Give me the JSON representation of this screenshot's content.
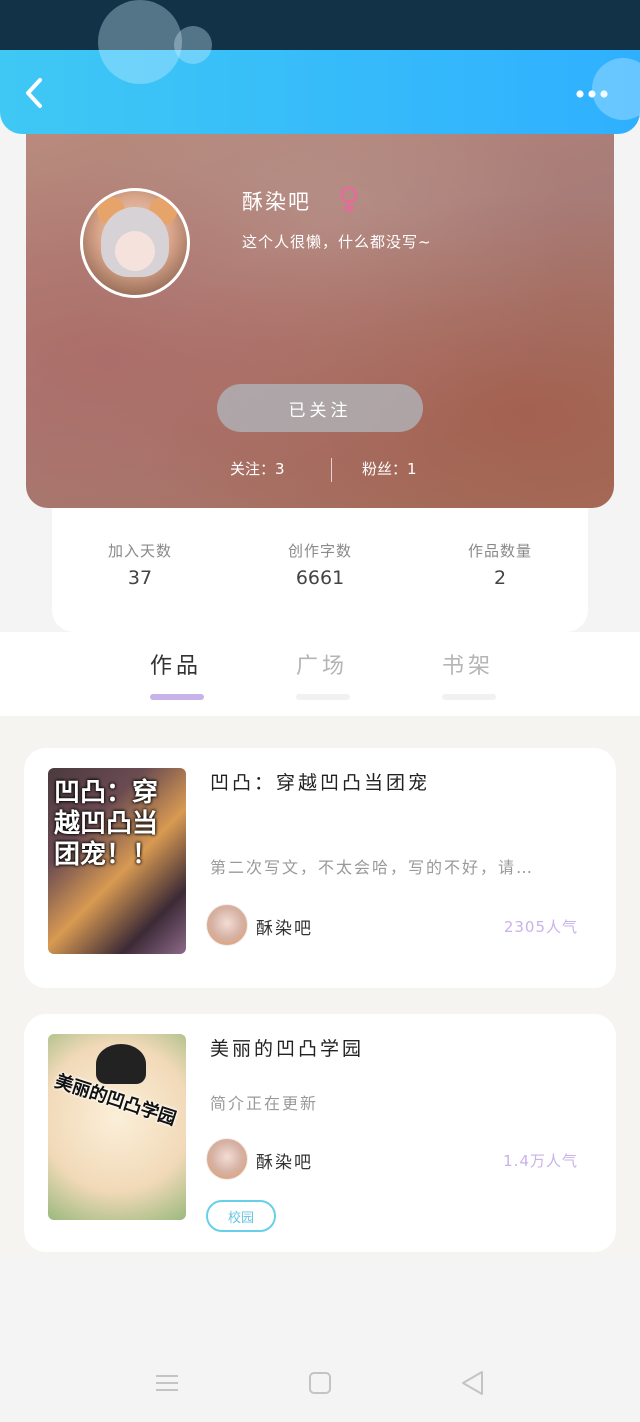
{
  "header": {
    "back_icon": "chevron-left-icon",
    "more_icon": "more-dots-icon",
    "colors": {
      "start": "#3fc8f4",
      "end": "#2fb0ff"
    }
  },
  "profile": {
    "username": "酥染吧",
    "gender_icon": "female-icon",
    "bio": "这个人很懒，什么都没写~",
    "follow_button": "已关注",
    "following_label": "关注：3",
    "fans_label": "粉丝：1"
  },
  "stats": [
    {
      "label": "加入天数",
      "value": "37"
    },
    {
      "label": "创作字数",
      "value": "6661"
    },
    {
      "label": "作品数量",
      "value": "2"
    }
  ],
  "tabs": [
    {
      "label": "作品",
      "active": true
    },
    {
      "label": "广场",
      "active": false
    },
    {
      "label": "书架",
      "active": false
    }
  ],
  "works": [
    {
      "title": "凹凸：穿越凹凸当团宠",
      "cover_text": "凹凸：穿越凹凸当团宠！！",
      "description": "第二次写文，不太会哈，写的不好，请…",
      "author": "酥染吧",
      "popularity": "2305人气"
    },
    {
      "title": "美丽的凹凸学园",
      "cover_text": "美丽的凹凸学园",
      "description": "简介正在更新",
      "author": "酥染吧",
      "popularity": "1.4万人气",
      "tag": "校园"
    }
  ],
  "system_nav": {
    "menu_icon": "menu-icon",
    "home_icon": "home-square-icon",
    "back_icon": "back-triangle-icon"
  }
}
